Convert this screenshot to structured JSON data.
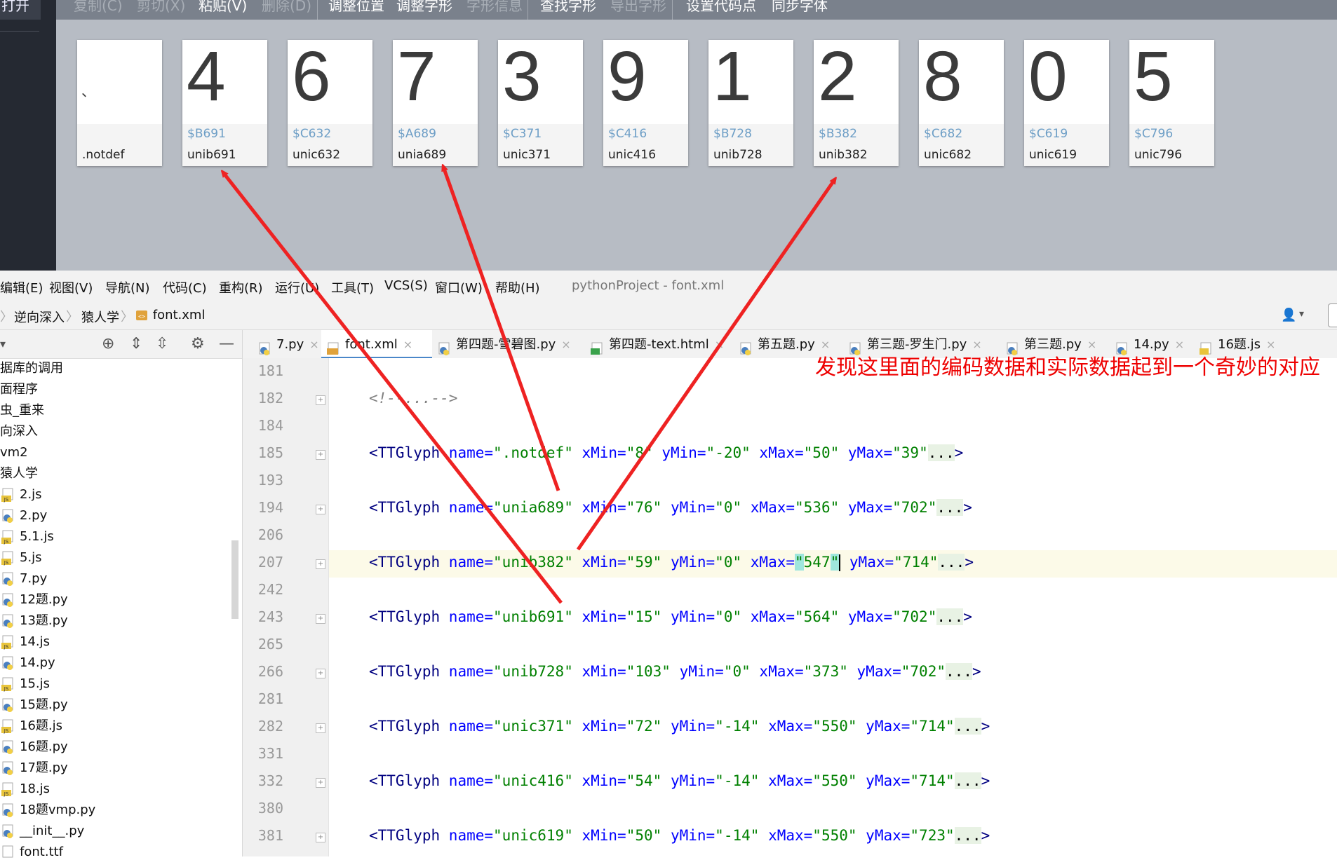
{
  "font_editor": {
    "sidebar_open_label": "打开",
    "toolbar": [
      {
        "label": "复制(C)",
        "enabled": false
      },
      {
        "label": "剪切(X)",
        "enabled": false
      },
      {
        "label": "粘贴(V)",
        "enabled": true
      },
      {
        "label": "删除(D)",
        "enabled": false
      },
      {
        "label": "调整位置",
        "enabled": true
      },
      {
        "label": "调整字形",
        "enabled": true
      },
      {
        "label": "字形信息",
        "enabled": false
      },
      {
        "label": "查找字形",
        "enabled": true
      },
      {
        "label": "导出字形",
        "enabled": false
      },
      {
        "label": "设置代码点",
        "enabled": true
      },
      {
        "label": "同步字体",
        "enabled": true
      }
    ],
    "glyphs": [
      {
        "char": "、",
        "code": "",
        "name": ".notdef"
      },
      {
        "char": "4",
        "code": "$B691",
        "name": "unib691"
      },
      {
        "char": "6",
        "code": "$C632",
        "name": "unic632"
      },
      {
        "char": "7",
        "code": "$A689",
        "name": "unia689"
      },
      {
        "char": "3",
        "code": "$C371",
        "name": "unic371"
      },
      {
        "char": "9",
        "code": "$C416",
        "name": "unic416"
      },
      {
        "char": "1",
        "code": "$B728",
        "name": "unib728"
      },
      {
        "char": "2",
        "code": "$B382",
        "name": "unib382"
      },
      {
        "char": "8",
        "code": "$C682",
        "name": "unic682"
      },
      {
        "char": "0",
        "code": "$C619",
        "name": "unic619"
      },
      {
        "char": "5",
        "code": "$C796",
        "name": "unic796"
      }
    ]
  },
  "ide": {
    "menu": [
      "编辑(E)",
      "视图(V)",
      "导航(N)",
      "代码(C)",
      "重构(R)",
      "运行(U)",
      "工具(T)",
      "VCS(S)",
      "窗口(W)",
      "帮助(H)"
    ],
    "window_title": "pythonProject - font.xml",
    "breadcrumb": [
      "逆向深入",
      "猿人学",
      "font.xml"
    ],
    "project_tree": [
      "据库的调用",
      "面程序",
      "虫_重来",
      "向深入",
      "vm2",
      "猿人学",
      "2.js",
      "2.py",
      "5.1.js",
      "5.js",
      "7.py",
      "12题.py",
      "13题.py",
      "14.js",
      "14.py",
      "15.js",
      "15题.py",
      "16题.js",
      "16题.py",
      "17题.py",
      "18.js",
      "18题vmp.py",
      "__init__.py",
      "font.ttf"
    ],
    "tabs": [
      {
        "label": "7.py",
        "active": false,
        "icon": "python-file-icon"
      },
      {
        "label": "font.xml",
        "active": true,
        "icon": "xml-file-icon"
      },
      {
        "label": "第四题-雪碧图.py",
        "active": false,
        "icon": "python-file-icon"
      },
      {
        "label": "第四题-text.html",
        "active": false,
        "icon": "html-file-icon"
      },
      {
        "label": "第五题.py",
        "active": false,
        "icon": "python-file-icon"
      },
      {
        "label": "第三题-罗生门.py",
        "active": false,
        "icon": "python-file-icon"
      },
      {
        "label": "第三题.py",
        "active": false,
        "icon": "python-file-icon"
      },
      {
        "label": "14.py",
        "active": false,
        "icon": "python-file-icon"
      },
      {
        "label": "16题.js",
        "active": false,
        "icon": "js-file-icon"
      }
    ],
    "code_lines": [
      {
        "ln": "181",
        "kind": "blank"
      },
      {
        "ln": "182",
        "kind": "comment",
        "text": "<!--...-->"
      },
      {
        "ln": "184",
        "kind": "blank"
      },
      {
        "ln": "185",
        "kind": "glyph",
        "name": ".notdef",
        "xMin": "8",
        "yMin": "-20",
        "xMax": "50",
        "yMax": "39"
      },
      {
        "ln": "193",
        "kind": "blank"
      },
      {
        "ln": "194",
        "kind": "glyph",
        "name": "unia689",
        "xMin": "76",
        "yMin": "0",
        "xMax": "536",
        "yMax": "702"
      },
      {
        "ln": "206",
        "kind": "blank"
      },
      {
        "ln": "207",
        "kind": "glyph",
        "name": "unib382",
        "xMin": "59",
        "yMin": "0",
        "xMax": "547",
        "yMax": "714",
        "current": true
      },
      {
        "ln": "242",
        "kind": "blank"
      },
      {
        "ln": "243",
        "kind": "glyph",
        "name": "unib691",
        "xMin": "15",
        "yMin": "0",
        "xMax": "564",
        "yMax": "702"
      },
      {
        "ln": "265",
        "kind": "blank"
      },
      {
        "ln": "266",
        "kind": "glyph",
        "name": "unib728",
        "xMin": "103",
        "yMin": "0",
        "xMax": "373",
        "yMax": "702"
      },
      {
        "ln": "281",
        "kind": "blank"
      },
      {
        "ln": "282",
        "kind": "glyph",
        "name": "unic371",
        "xMin": "72",
        "yMin": "-14",
        "xMax": "550",
        "yMax": "714"
      },
      {
        "ln": "331",
        "kind": "blank"
      },
      {
        "ln": "332",
        "kind": "glyph",
        "name": "unic416",
        "xMin": "54",
        "yMin": "-14",
        "xMax": "550",
        "yMax": "714"
      },
      {
        "ln": "380",
        "kind": "blank"
      },
      {
        "ln": "381",
        "kind": "glyph",
        "name": "unic619",
        "xMin": "50",
        "yMin": "-14",
        "xMax": "550",
        "yMax": "723"
      }
    ]
  },
  "annotation": {
    "text": "发现这里面的编码数据和实际数据起到一个奇妙的对应",
    "color": "#ee0000"
  }
}
